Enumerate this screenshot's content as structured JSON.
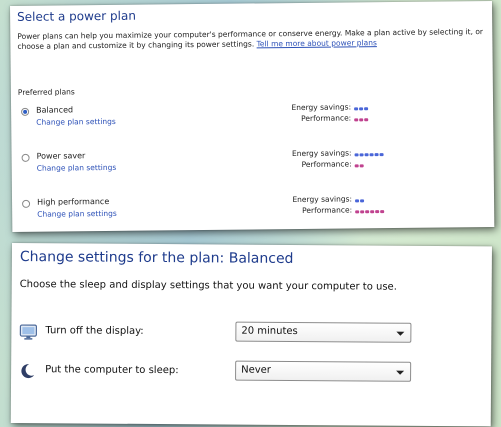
{
  "power_plans": {
    "title": "Select a power plan",
    "description": "Power plans can help you maximize your computer's performance or conserve energy. Make a plan active by selecting it, or choose a plan and customize it by changing its power settings.",
    "learn_more_link": "Tell me more about power plans",
    "group_label": "Preferred plans",
    "energy_label": "Energy savings:",
    "performance_label": "Performance:",
    "plans": [
      {
        "name": "Balanced",
        "link": "Change plan settings",
        "selected": true,
        "energy_level": 3,
        "performance_level": 3
      },
      {
        "name": "Power saver",
        "link": "Change plan settings",
        "selected": false,
        "energy_level": 6,
        "performance_level": 2
      },
      {
        "name": "High performance",
        "link": "Change plan settings",
        "selected": false,
        "energy_level": 2,
        "performance_level": 6
      }
    ],
    "colors": {
      "energy_dots": "#4a66d8",
      "performance_dots": "#c0428f"
    }
  },
  "plan_settings": {
    "title": "Change settings for the plan: Balanced",
    "description": "Choose the sleep and display settings that you want your computer to use.",
    "rows": [
      {
        "icon": "monitor-icon",
        "label": "Turn off the display:",
        "value": "20 minutes"
      },
      {
        "icon": "moon-icon",
        "label": "Put the computer to sleep:",
        "value": "Never"
      }
    ]
  }
}
